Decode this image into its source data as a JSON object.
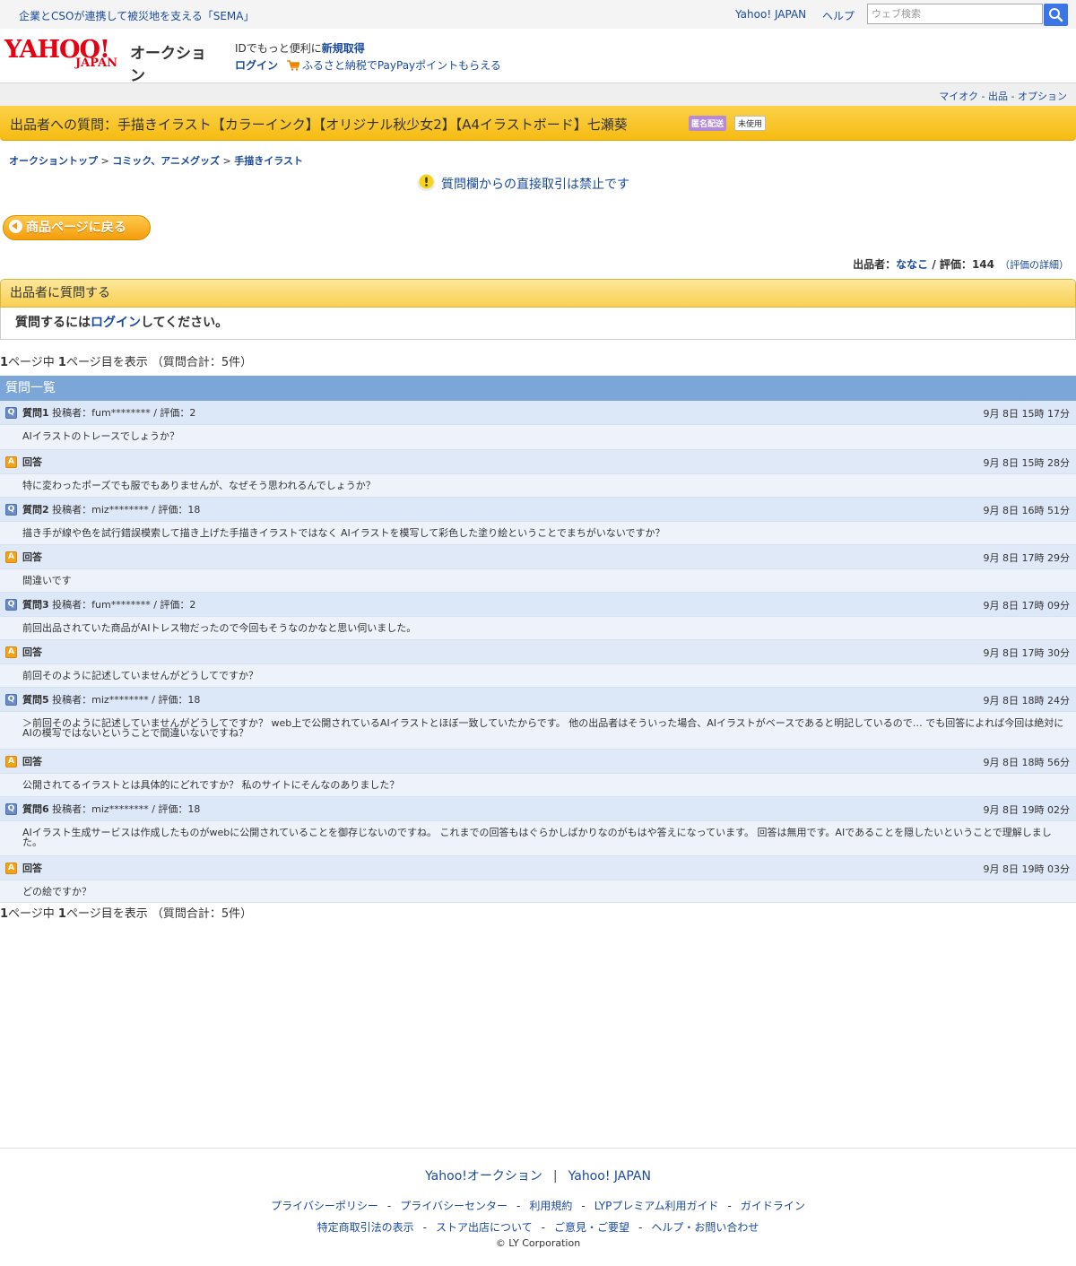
{
  "top": {
    "promo": "企業とCSOが連携して被災地を支える「SEMA」",
    "yahoo_japan": "Yahoo! JAPAN",
    "help": "ヘルプ",
    "search_placeholder": "ウェブ検索"
  },
  "header": {
    "logo_main": "YAHOO!",
    "logo_sub": "JAPAN",
    "logo_service": "オークション",
    "id_prefix": "IDでもっと便利に",
    "id_link": "新規取得",
    "login": "ログイン",
    "furusato": "ふるさと納税でPayPayポイントもらえる"
  },
  "subnav": {
    "links": "マイオク - 出品 - オプション"
  },
  "title": {
    "text": "出品者への質問：手描きイラスト【カラーインク】【オリジナル秋少女2】【A4イラストボード】七瀬葵",
    "badge_shipping": "匿名配送",
    "badge_condition": "未使用"
  },
  "breadcrumb": {
    "item1": "オークショントップ",
    "item2": "コミック、アニメグッズ",
    "item3": "手描きイラスト",
    "sep": " > "
  },
  "warning": "質問欄からの直接取引は禁止です",
  "back_button": "商品ページに戻る",
  "seller": {
    "label": "出品者：",
    "name": "ななこ",
    "sep": " / ",
    "rating_label": "評価：",
    "rating": "144",
    "detail": "（評価の詳細）"
  },
  "ask": {
    "header": "出品者に質問する",
    "prefix": "質問するには",
    "login": "ログイン",
    "suffix": "してください。"
  },
  "pager": {
    "p1": "1",
    "mid": "ページ中 ",
    "p2": "1",
    "tail": "ページ目を表示 （質問合計：5件）"
  },
  "list": {
    "header": "質問一覧",
    "q_icon": "Q",
    "a_icon": "A",
    "items": [
      {
        "q_label": "質問1",
        "q_meta": " 投稿者：fum******** / 評価：2",
        "q_time": "9月 8日 15時 17分",
        "q_text": "AIイラストのトレースでしょうか？",
        "a_label": "回答",
        "a_time": "9月 8日 15時 28分",
        "a_text": "特に変わったポーズでも服でもありませんが、なぜそう思われるんでしょうか？"
      },
      {
        "q_label": "質問2",
        "q_meta": " 投稿者：miz******** / 評価：18",
        "q_time": "9月 8日 16時 51分",
        "q_text": "描き手が線や色を試行錯誤模索して描き上げた手描きイラストではなく AIイラストを模写して彩色した塗り絵ということでまちがいないですか？",
        "a_label": "回答",
        "a_time": "9月 8日 17時 29分",
        "a_text": "間違いです"
      },
      {
        "q_label": "質問3",
        "q_meta": " 投稿者：fum******** / 評価：2",
        "q_time": "9月 8日 17時 09分",
        "q_text": "前回出品されていた商品がAIトレス物だったので今回もそうなのかなと思い伺いました。",
        "a_label": "回答",
        "a_time": "9月 8日 17時 30分",
        "a_text": "前回そのように記述していませんがどうしてですか？"
      },
      {
        "q_label": "質問5",
        "q_meta": " 投稿者：miz******** / 評価：18",
        "q_time": "9月 8日 18時 24分",
        "q_text": "＞前回そのように記述していませんがどうしてですか？ web上で公開されているAIイラストとほぼ一致していたからです。 他の出品者はそういった場合、AIイラストがベースであると明記しているので… でも回答によれば今回は絶対にAIの模写ではないということで間違いないですね？",
        "a_label": "回答",
        "a_time": "9月 8日 18時 56分",
        "a_text": "公開されてるイラストとは具体的にどれですか？ 私のサイトにそんなのありました？"
      },
      {
        "q_label": "質問6",
        "q_meta": " 投稿者：miz******** / 評価：18",
        "q_time": "9月 8日 19時 02分",
        "q_text": "AIイラスト生成サービスは作成したものがwebに公開されていることを御存じないのですね。 これまでの回答もはぐらかしばかりなのがもはや答えになっています。 回答は無用です。AIであることを隠したいということで理解しました。",
        "a_label": "回答",
        "a_time": "9月 8日 19時 03分",
        "a_text": "どの絵ですか？"
      }
    ]
  },
  "footer": {
    "auction": "Yahoo!オークション",
    "yj": "Yahoo! JAPAN",
    "links1": [
      "プライバシーポリシー",
      "プライバシーセンター",
      "利用規約",
      "LYPプレミアム利用ガイド",
      "ガイドライン"
    ],
    "links2": [
      "特定商取引法の表示",
      "ストア出店について",
      "ご意見・ご要望",
      "ヘルプ・お問い合わせ"
    ],
    "copyright": "© LY Corporation"
  },
  "colors": {
    "accent_yellow": "#f6bb12",
    "link_blue": "#1a4a9c",
    "list_header": "#7ca6d8",
    "yahoo_red": "#e60012"
  }
}
